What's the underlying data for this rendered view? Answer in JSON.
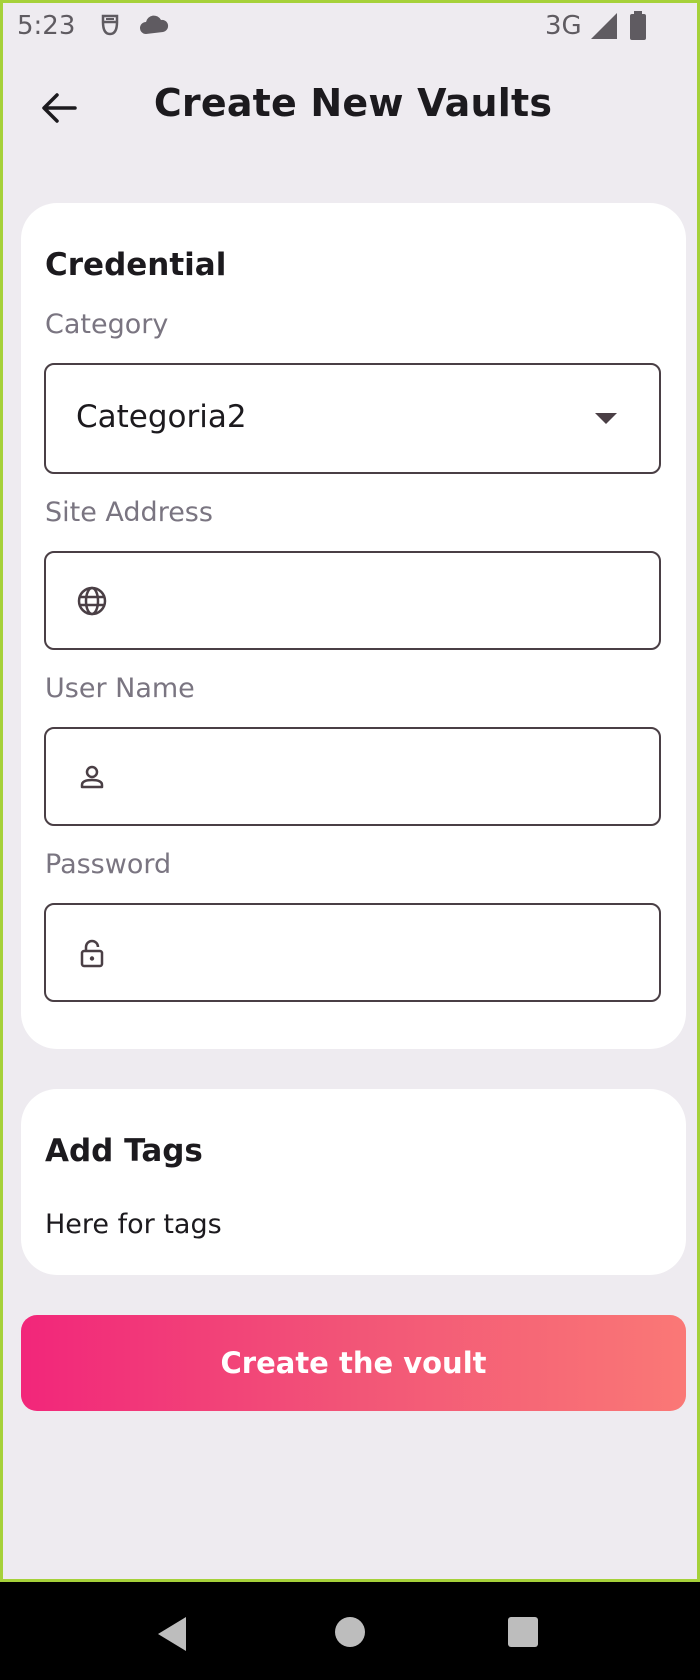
{
  "status_bar": {
    "time": "5:23",
    "network": "3G",
    "icons": [
      "sim-icon",
      "cloud-icon",
      "signal-icon",
      "battery-icon"
    ]
  },
  "header": {
    "title": "Create New Vaults",
    "back_icon": "arrow-left-icon"
  },
  "credential": {
    "title": "Credential",
    "category": {
      "label": "Category",
      "value": "Categoria2"
    },
    "site_address": {
      "label": "Site Address",
      "icon": "globe-icon",
      "value": ""
    },
    "user_name": {
      "label": "User Name",
      "icon": "person-icon",
      "value": ""
    },
    "password": {
      "label": "Password",
      "icon": "lock-icon",
      "value": ""
    }
  },
  "tags": {
    "title": "Add Tags",
    "text": "Here for tags"
  },
  "create_button": {
    "label": "Create the voult"
  },
  "colors": {
    "background": "#EEEBF0",
    "card": "#FFFFFF",
    "gradient_start": "#F2267A",
    "gradient_end": "#FA7876",
    "label": "#7A7581"
  }
}
